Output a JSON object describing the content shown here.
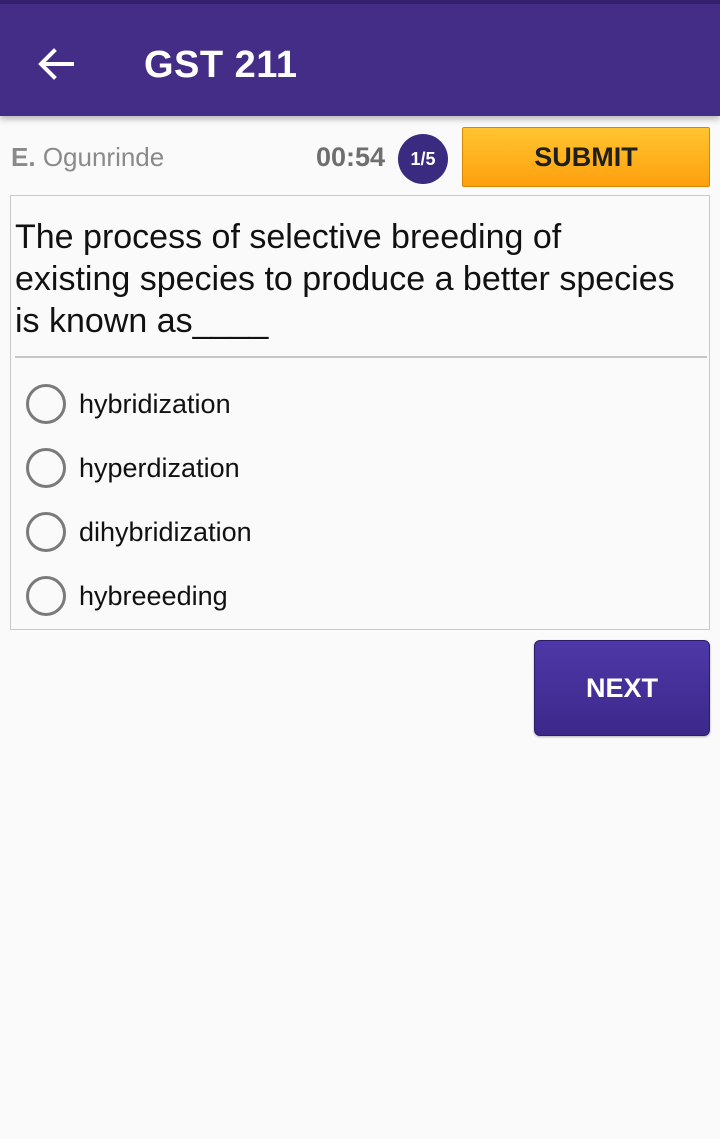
{
  "appbar": {
    "title": "GST 211",
    "back_icon": "arrow-left-icon",
    "color": "#432d86"
  },
  "info": {
    "student_initial": "E.",
    "student_surname": "Ogunrinde",
    "timer": "00:54",
    "progress": "1/5",
    "submit_label": "SUBMIT"
  },
  "question": {
    "text": "The process of selective breeding of existing species to produce a better species is known as____",
    "options": [
      {
        "label": "hybridization",
        "selected": false
      },
      {
        "label": "hyperdization",
        "selected": false
      },
      {
        "label": "dihybridization",
        "selected": false
      },
      {
        "label": "hybreeeding",
        "selected": false
      }
    ]
  },
  "navigation": {
    "next_label": "NEXT"
  },
  "colors": {
    "primary": "#432d86",
    "accent": "#ffb020",
    "badge": "#3a2a80"
  }
}
